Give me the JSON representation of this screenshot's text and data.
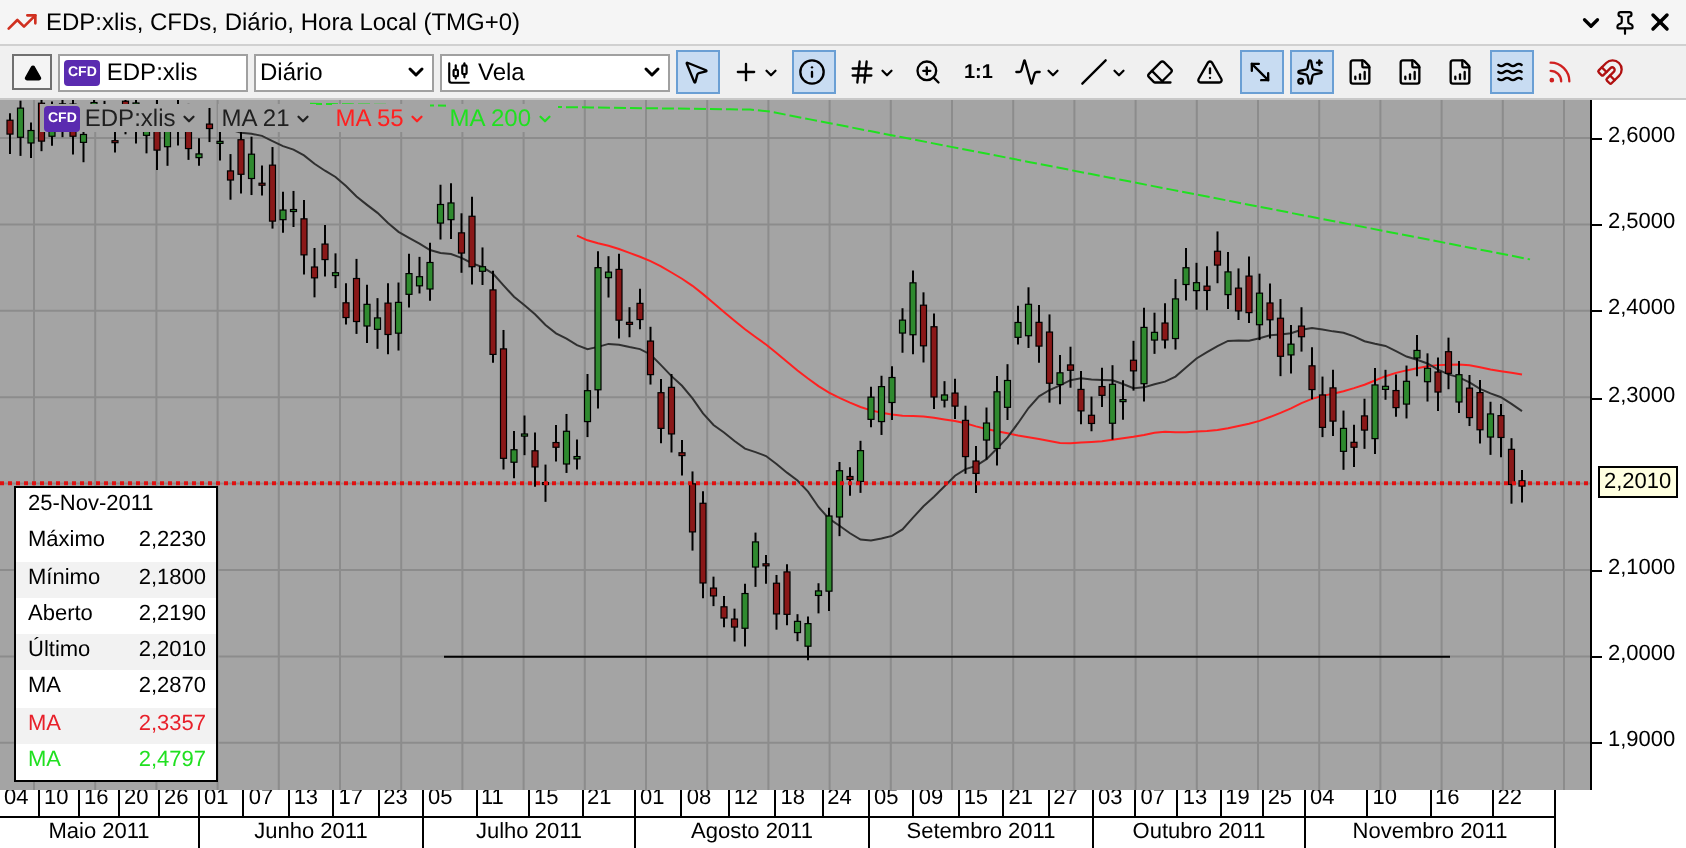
{
  "window": {
    "title": "EDP:xlis, CFDs, Diário, Hora Local (TMG+0)"
  },
  "toolbar": {
    "symbol": {
      "badge": "CFD",
      "value": "EDP:xlis"
    },
    "period": {
      "value": "Diário"
    },
    "chart_type": {
      "value": "Vela"
    },
    "tools": [
      {
        "kind": "pointer",
        "selected": true,
        "dropdown": false
      },
      {
        "kind": "crosshair",
        "selected": false,
        "dropdown": true
      },
      {
        "kind": "info",
        "selected": true,
        "dropdown": false
      },
      {
        "kind": "grid",
        "selected": false,
        "dropdown": true
      },
      {
        "kind": "zoom",
        "selected": false,
        "dropdown": false
      },
      {
        "kind": "text",
        "label": "1:1",
        "selected": false,
        "dropdown": false
      },
      {
        "kind": "indicator",
        "selected": false,
        "dropdown": true
      },
      {
        "kind": "line",
        "selected": false,
        "dropdown": true
      },
      {
        "kind": "eraser",
        "selected": false,
        "dropdown": false
      },
      {
        "kind": "alert",
        "selected": false,
        "dropdown": false
      },
      {
        "kind": "autoscale",
        "selected": true,
        "dropdown": false
      },
      {
        "kind": "pattern",
        "selected": true,
        "dropdown": false
      },
      {
        "kind": "template",
        "selected": false,
        "dropdown": false
      },
      {
        "kind": "template",
        "selected": false,
        "dropdown": false
      },
      {
        "kind": "template",
        "selected": false,
        "dropdown": false
      },
      {
        "kind": "wave",
        "selected": true,
        "dropdown": false
      },
      {
        "kind": "signal",
        "selected": false,
        "dropdown": false
      },
      {
        "kind": "magnet",
        "selected": false,
        "dropdown": false
      }
    ]
  },
  "chart": {
    "legend": [
      {
        "label": "EDP:xlis",
        "badge": "CFD",
        "color": "#202020"
      },
      {
        "label": "MA 21",
        "color": "#202020"
      },
      {
        "label": "MA 55",
        "color": "#ff2020"
      },
      {
        "label": "MA 200",
        "color": "#20e020"
      }
    ],
    "info": {
      "date": "25-Nov-2011",
      "rows": [
        {
          "label": "Máximo",
          "value": "2,2230",
          "color": "#000000"
        },
        {
          "label": "Mínimo",
          "value": "2,1800",
          "color": "#000000"
        },
        {
          "label": "Aberto",
          "value": "2,2190",
          "color": "#000000"
        },
        {
          "label": "Último",
          "value": "2,2010",
          "color": "#000000"
        },
        {
          "label": "MA",
          "value": "2,2870",
          "color": "#000000"
        },
        {
          "label": "MA",
          "value": "2,3357",
          "color": "#e8202a"
        },
        {
          "label": "MA",
          "value": "2,4797",
          "color": "#20e020"
        }
      ]
    },
    "y_ticks": [
      "2,6000",
      "2,5000",
      "2,4000",
      "2,3000",
      "2,1000",
      "2,0000",
      "1,9000"
    ],
    "last_price": "2,2010",
    "x_axis": {
      "months": [
        {
          "label": "Maio 2011",
          "days": [
            "04",
            "10",
            "16",
            "20",
            "26"
          ]
        },
        {
          "label": "Junho 2011",
          "days": [
            "01",
            "07",
            "13",
            "17",
            "23"
          ]
        },
        {
          "label": "Julho 2011",
          "days": [
            "05",
            "11",
            "15",
            "21"
          ]
        },
        {
          "label": "Agosto 2011",
          "days": [
            "01",
            "08",
            "12",
            "18",
            "24"
          ]
        },
        {
          "label": "Setembro 2011",
          "days": [
            "05",
            "09",
            "15",
            "21",
            "27"
          ]
        },
        {
          "label": "Outubro 2011",
          "days": [
            "03",
            "07",
            "13",
            "19",
            "25"
          ]
        },
        {
          "label": "Novembro 2011",
          "days": [
            "04",
            "10",
            "16",
            "22"
          ]
        }
      ]
    }
  }
}
